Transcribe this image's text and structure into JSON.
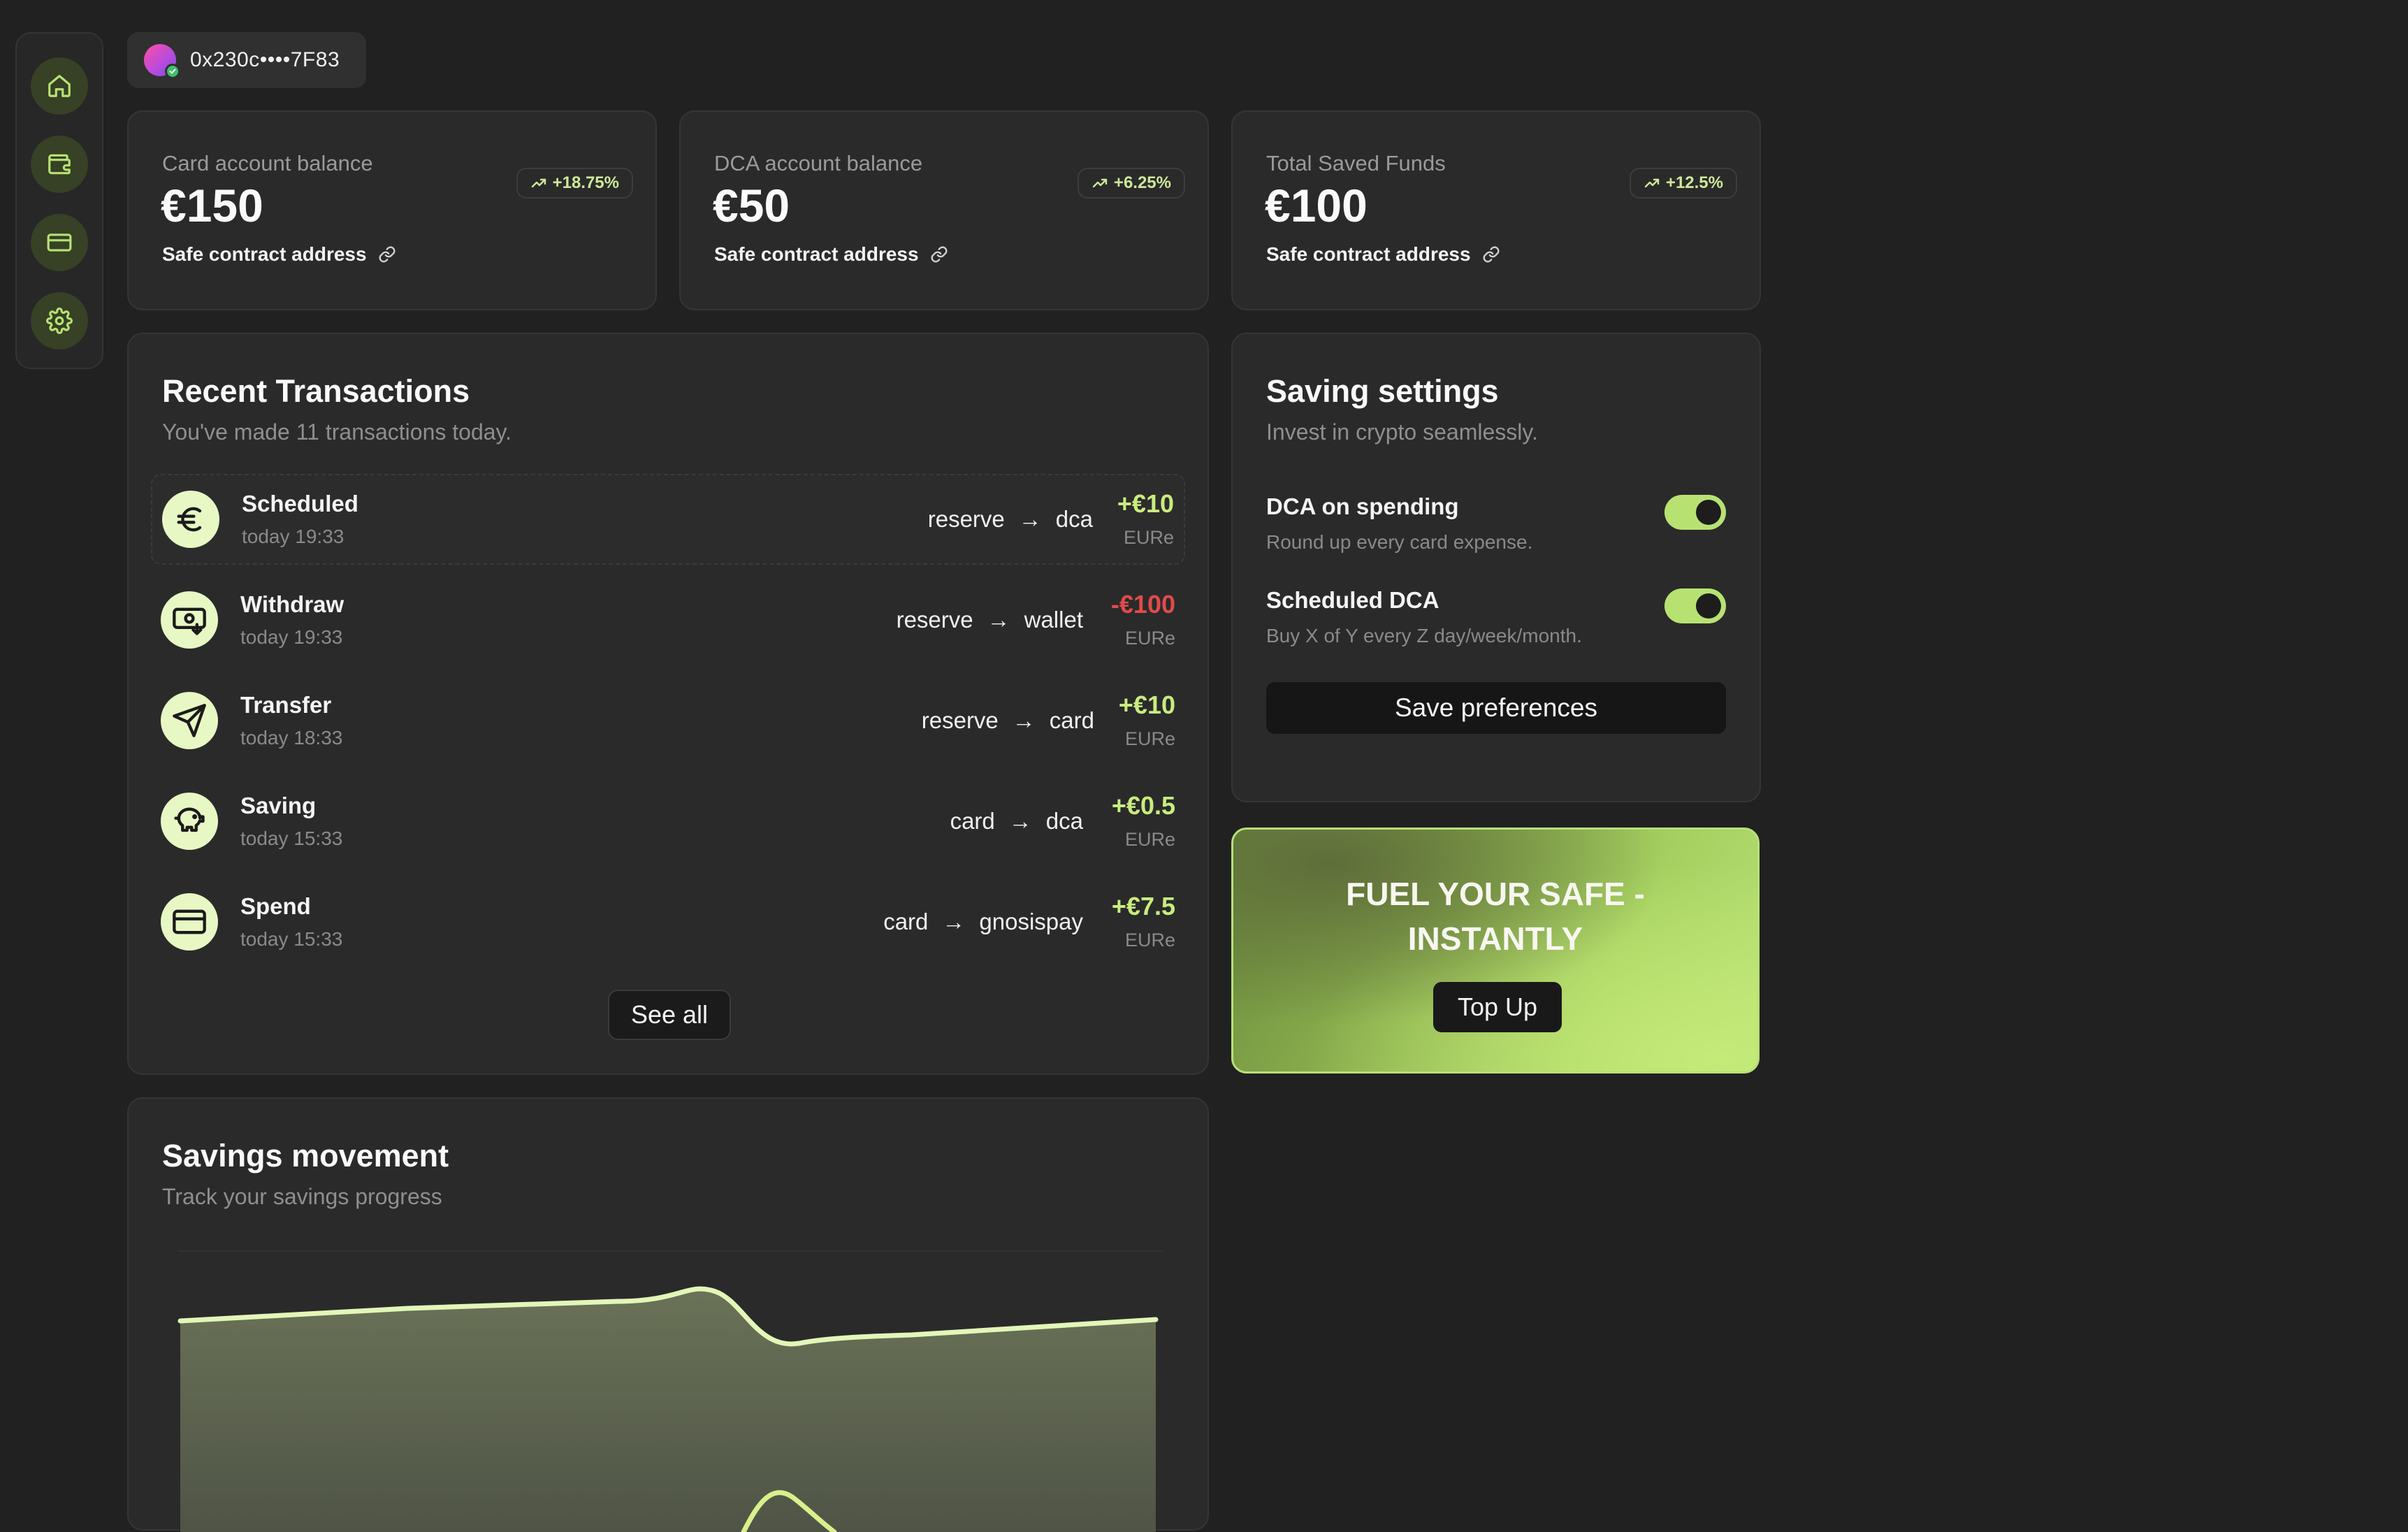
{
  "wallet": {
    "address": "0x230c••••7F83"
  },
  "balances": [
    {
      "label": "Card account balance",
      "value": "€150",
      "change": "+18.75%",
      "link": "Safe contract address"
    },
    {
      "label": "DCA account balance",
      "value": "€50",
      "change": "+6.25%",
      "link": "Safe contract address"
    },
    {
      "label": "Total Saved Funds",
      "value": "€100",
      "change": "+12.5%",
      "link": "Safe contract address"
    }
  ],
  "transactions": {
    "title": "Recent Transactions",
    "subtitle": "You've made 11 transactions today.",
    "items": [
      {
        "title": "Scheduled",
        "time": "today 19:33",
        "from": "reserve",
        "to": "dca",
        "amount": "+€10",
        "currency": "EURe",
        "icon": "euro-icon"
      },
      {
        "title": "Withdraw",
        "time": "today 19:33",
        "from": "reserve",
        "to": "wallet",
        "amount": "-€100",
        "currency": "EURe",
        "icon": "withdraw-icon"
      },
      {
        "title": "Transfer",
        "time": "today 18:33",
        "from": "reserve",
        "to": "card",
        "amount": "+€10",
        "currency": "EURe",
        "icon": "send-icon"
      },
      {
        "title": "Saving",
        "time": "today 15:33",
        "from": "card",
        "to": "dca",
        "amount": "+€0.5",
        "currency": "EURe",
        "icon": "piggy-bank-icon"
      },
      {
        "title": "Spend",
        "time": "today 15:33",
        "from": "card",
        "to": "gnosispay",
        "amount": "+€7.5",
        "currency": "EURe",
        "icon": "credit-card-icon"
      }
    ],
    "see_all": "See all"
  },
  "settings": {
    "title": "Saving settings",
    "subtitle": "Invest in crypto seamlessly.",
    "prefs": [
      {
        "title": "DCA on spending",
        "desc": "Round up every card expense.",
        "enabled": true
      },
      {
        "title": "Scheduled DCA",
        "desc": "Buy X of Y every Z day/week/month.",
        "enabled": true
      }
    ],
    "save_label": "Save preferences"
  },
  "promo": {
    "title": "FUEL YOUR SAFE - INSTANTLY",
    "button": "Top Up"
  },
  "savings": {
    "title": "Savings movement",
    "subtitle": "Track your savings progress"
  },
  "nav": [
    "home-icon",
    "wallet-icon",
    "credit-card-icon",
    "gear-icon"
  ],
  "colors": {
    "accent": "#b7e272",
    "positive": "#c8ec7e",
    "negative": "#e04b4b",
    "background": "#212121",
    "card": "#2a2a2a"
  }
}
